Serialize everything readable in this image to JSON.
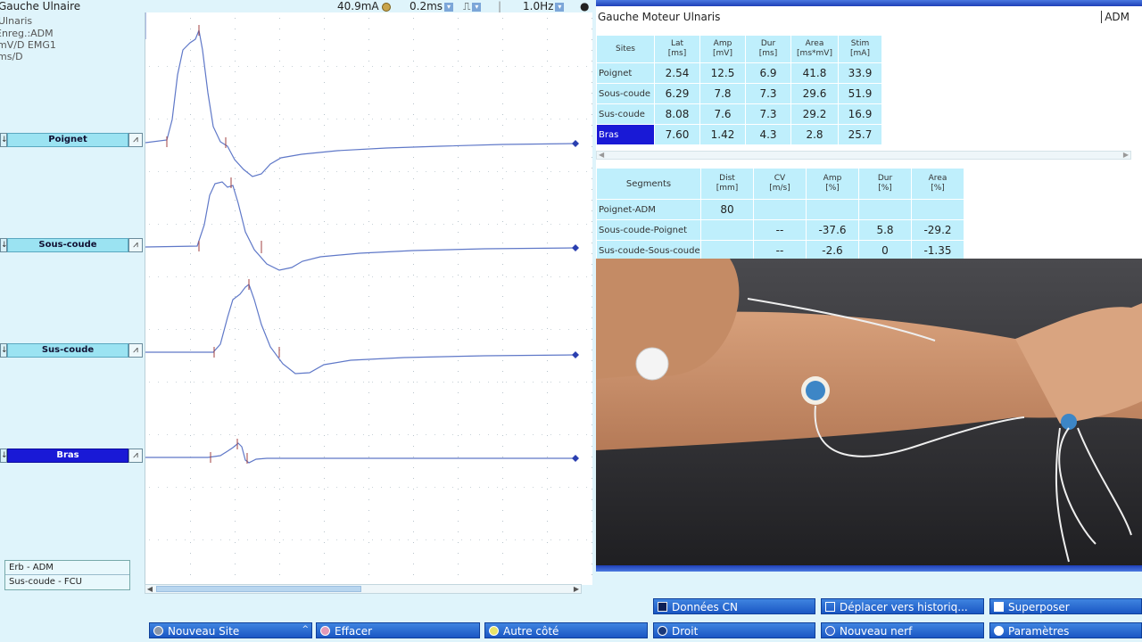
{
  "left_panel": {
    "title": "Gauche Ulnaire",
    "nerve": "Ulnaris",
    "record": "Enreg.:ADM",
    "sensitivity": "mV/D  EMG1",
    "sweep": "ms/D",
    "sites": [
      "Poignet",
      "Sous-coude",
      "Sus-coude",
      "Bras"
    ],
    "erb_items": [
      "Erb - ADM",
      "Sus-coude - FCU"
    ]
  },
  "top_controls": {
    "stim": "40.9mA",
    "duration": "0.2ms",
    "rate": "1.0Hz"
  },
  "right_header": {
    "title": "Gauche Moteur Ulnaris",
    "muscle": "ADM"
  },
  "sites_table": {
    "headers": [
      {
        "top": "Sites",
        "unit": ""
      },
      {
        "top": "Lat",
        "unit": "[ms]"
      },
      {
        "top": "Amp",
        "unit": "[mV]"
      },
      {
        "top": "Dur",
        "unit": "[ms]"
      },
      {
        "top": "Area",
        "unit": "[ms*mV]"
      },
      {
        "top": "Stim",
        "unit": "[mA]"
      }
    ],
    "rows": [
      {
        "site": "Poignet",
        "lat": "2.54",
        "amp": "12.5",
        "dur": "6.9",
        "area": "41.8",
        "stim": "33.9"
      },
      {
        "site": "Sous-coude",
        "lat": "6.29",
        "amp": "7.8",
        "dur": "7.3",
        "area": "29.6",
        "stim": "51.9"
      },
      {
        "site": "Sus-coude",
        "lat": "8.08",
        "amp": "7.6",
        "dur": "7.3",
        "area": "29.2",
        "stim": "16.9"
      },
      {
        "site": "Bras",
        "lat": "7.60",
        "amp": "1.42",
        "dur": "4.3",
        "area": "2.8",
        "stim": "25.7"
      }
    ]
  },
  "segments_table": {
    "headers": [
      {
        "top": "Segments",
        "unit": ""
      },
      {
        "top": "Dist",
        "unit": "[mm]"
      },
      {
        "top": "CV",
        "unit": "[m/s]"
      },
      {
        "top": "Amp",
        "unit": "[%]"
      },
      {
        "top": "Dur",
        "unit": "[%]"
      },
      {
        "top": "Area",
        "unit": "[%]"
      }
    ],
    "rows": [
      {
        "seg": "Poignet-ADM",
        "dist": "80",
        "cv": "",
        "amp": "",
        "dur": "",
        "area": ""
      },
      {
        "seg": "Sous-coude-Poignet",
        "dist": "",
        "cv": "--",
        "amp": "-37.6",
        "dur": "5.8",
        "area": "-29.2"
      },
      {
        "seg": "Sus-coude-Sous-coude",
        "dist": "",
        "cv": "--",
        "amp": "-2.6",
        "dur": "0",
        "area": "-1.35"
      }
    ]
  },
  "buttons": {
    "donnees_cn": "Données CN",
    "deplacer": "Déplacer vers historiq...",
    "superposer": "Superposer",
    "nouveau_site": "Nouveau Site",
    "effacer": "Effacer",
    "autre_cote": "Autre côté",
    "droit": "Droit",
    "nouveau_nerf": "Nouveau nerf",
    "parametres": "Paramètres"
  },
  "colors": {
    "active_site": "#1919d6",
    "button_blue": "#1a57c4",
    "trace": "#5f78c8",
    "cell_bg": "#bfeffc"
  }
}
